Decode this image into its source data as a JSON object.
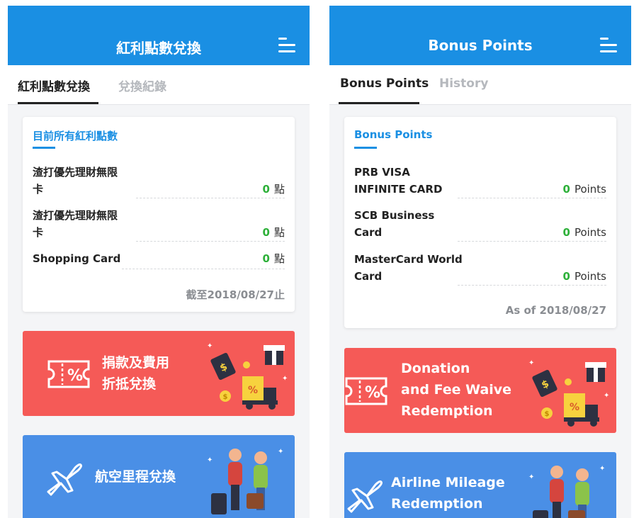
{
  "left": {
    "app_title": "紅利點數兌換",
    "tabs": [
      {
        "label": "紅利點數兌換"
      },
      {
        "label": "兌換紀錄"
      }
    ],
    "card": {
      "title": "目前所有紅利點數",
      "rows": [
        {
          "name_line1": "渣打優先理財無限",
          "name_line2": "卡",
          "value": "0",
          "unit": "點"
        },
        {
          "name_line1": "渣打優先理財無限",
          "name_line2": "卡",
          "value": "0",
          "unit": "點"
        },
        {
          "name_line1": "Shopping Card",
          "name_line2": "",
          "value": "0",
          "unit": "點"
        }
      ],
      "as_of": "截至2018/08/27止"
    },
    "banners": [
      {
        "line1": "捐款及費用",
        "line2": "折抵兌換"
      },
      {
        "line1": "航空里程兌換"
      }
    ]
  },
  "right": {
    "app_title": "Bonus Points",
    "tabs": [
      {
        "label": "Bonus Points"
      },
      {
        "label": "History"
      }
    ],
    "card": {
      "title": "Bonus Points",
      "rows": [
        {
          "name_line1": "PRB VISA",
          "name_line2": "INFINITE CARD",
          "value": "0",
          "unit": "Points"
        },
        {
          "name_line1": "SCB Business",
          "name_line2": "Card",
          "value": "0",
          "unit": "Points"
        },
        {
          "name_line1": "MasterCard World",
          "name_line2": "Card",
          "value": "0",
          "unit": "Points"
        }
      ],
      "as_of": "As of 2018/08/27"
    },
    "banners": [
      {
        "line1": "Donation",
        "line2": "and Fee Waive",
        "line3": "Redemption"
      },
      {
        "line1": "Airline Mileage",
        "line2": "Redemption"
      }
    ]
  },
  "icons": {
    "menu": "hamburger-menu-icon",
    "coupon": "coupon-percent-icon",
    "gift": "gift-box-icon",
    "price_tag": "dollar-tag-icon",
    "coin": "dollar-coin-icon",
    "truck": "delivery-truck-icon",
    "plane": "airplane-icon",
    "travelers": "travelers-illustration"
  },
  "colors": {
    "brand_blue": "#1a8fe3",
    "points_green": "#2db039",
    "donation_red": "#f55a57",
    "airline_blue": "#4a8fe6"
  }
}
